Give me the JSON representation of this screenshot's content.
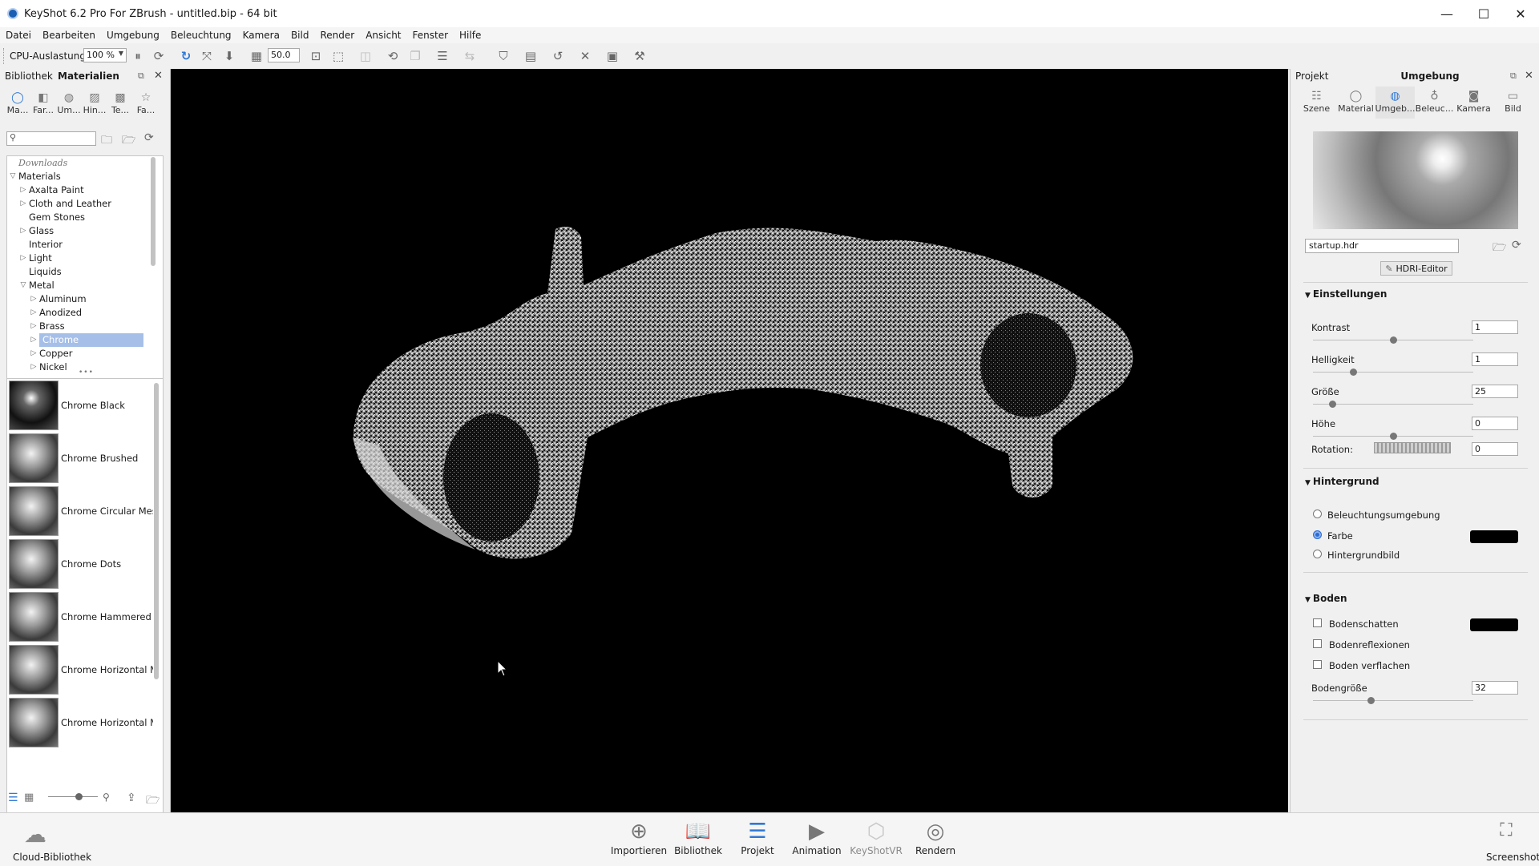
{
  "window": {
    "title": "KeyShot 6.2 Pro For ZBrush - untitled.bip  - 64 bit",
    "minimize": "—",
    "maximize": "☐",
    "close": "✕"
  },
  "menu": [
    "Datei",
    "Bearbeiten",
    "Umgebung",
    "Beleuchtung",
    "Kamera",
    "Bild",
    "Render",
    "Ansicht",
    "Fenster",
    "Hilfe"
  ],
  "toolbar": {
    "cpu_label": "CPU-Auslastung",
    "cpu_value": "100 %",
    "zoom_value": "50.0"
  },
  "left_panel": {
    "header_tabs": [
      "Bibliothek",
      "Materialien"
    ],
    "categories": [
      "Ma...",
      "Far...",
      "Um...",
      "Hin...",
      "Te...",
      "Fa..."
    ],
    "search_placeholder": "",
    "tree": [
      {
        "label": "Downloads",
        "level": 0,
        "italic": true
      },
      {
        "label": "Materials",
        "level": 0,
        "open": true
      },
      {
        "label": "Axalta Paint",
        "level": 1,
        "arrow": true
      },
      {
        "label": "Cloth and Leather",
        "level": 1,
        "arrow": true
      },
      {
        "label": "Gem Stones",
        "level": 1
      },
      {
        "label": "Glass",
        "level": 1,
        "arrow": true
      },
      {
        "label": "Interior",
        "level": 1
      },
      {
        "label": "Light",
        "level": 1,
        "arrow": true
      },
      {
        "label": "Liquids",
        "level": 1
      },
      {
        "label": "Metal",
        "level": 1,
        "open": true
      },
      {
        "label": "Aluminum",
        "level": 2,
        "arrow": true
      },
      {
        "label": "Anodized",
        "level": 2,
        "arrow": true
      },
      {
        "label": "Brass",
        "level": 2,
        "arrow": true
      },
      {
        "label": "Chrome",
        "level": 2,
        "arrow": true,
        "selected": true
      },
      {
        "label": "Copper",
        "level": 2,
        "arrow": true
      },
      {
        "label": "Nickel",
        "level": 2,
        "arrow": true
      }
    ],
    "materials": [
      "Chrome Black",
      "Chrome Brushed",
      "Chrome Circular Mesh",
      "Chrome Dots",
      "Chrome Hammered",
      "Chrome Horizontal Me",
      "Chrome Horizontal Me"
    ]
  },
  "right_panel": {
    "header_left": "Projekt",
    "header_title": "Umgebung",
    "tabs": [
      "Szene",
      "Material",
      "Umgeb...",
      "Beleuc...",
      "Kamera",
      "Bild"
    ],
    "hdr_file": "startup.hdr",
    "hdri_editor": "HDRI-Editor",
    "settings_title": "Einstellungen",
    "params": [
      {
        "label": "Kontrast",
        "value": "1",
        "slider": 0.5
      },
      {
        "label": "Helligkeit",
        "value": "1",
        "slider": 0.25
      },
      {
        "label": "Größe",
        "value": "25",
        "slider": 0.12
      },
      {
        "label": "Höhe",
        "value": "0",
        "slider": 0.5
      }
    ],
    "rotation_label": "Rotation:",
    "rotation_value": "0",
    "background_title": "Hintergrund",
    "background_options": [
      "Beleuchtungsumgebung",
      "Farbe",
      "Hintergrundbild"
    ],
    "background_selected": 1,
    "floor_title": "Boden",
    "floor_options": [
      "Bodenschatten",
      "Bodenreflexionen",
      "Boden verflachen"
    ],
    "floor_size_label": "Bodengröße",
    "floor_size_value": "32",
    "floor_size_slider": 0.36,
    "swatch_color": "#000000"
  },
  "bottom": {
    "cloud": "Cloud-Bibliothek",
    "buttons": [
      "Importieren",
      "Bibliothek",
      "Projekt",
      "Animation",
      "KeyShotVR",
      "Rendern"
    ],
    "screenshot": "Screenshot"
  },
  "colors": {
    "accent": "#2f78d6",
    "selection": "#a6bfe8"
  }
}
